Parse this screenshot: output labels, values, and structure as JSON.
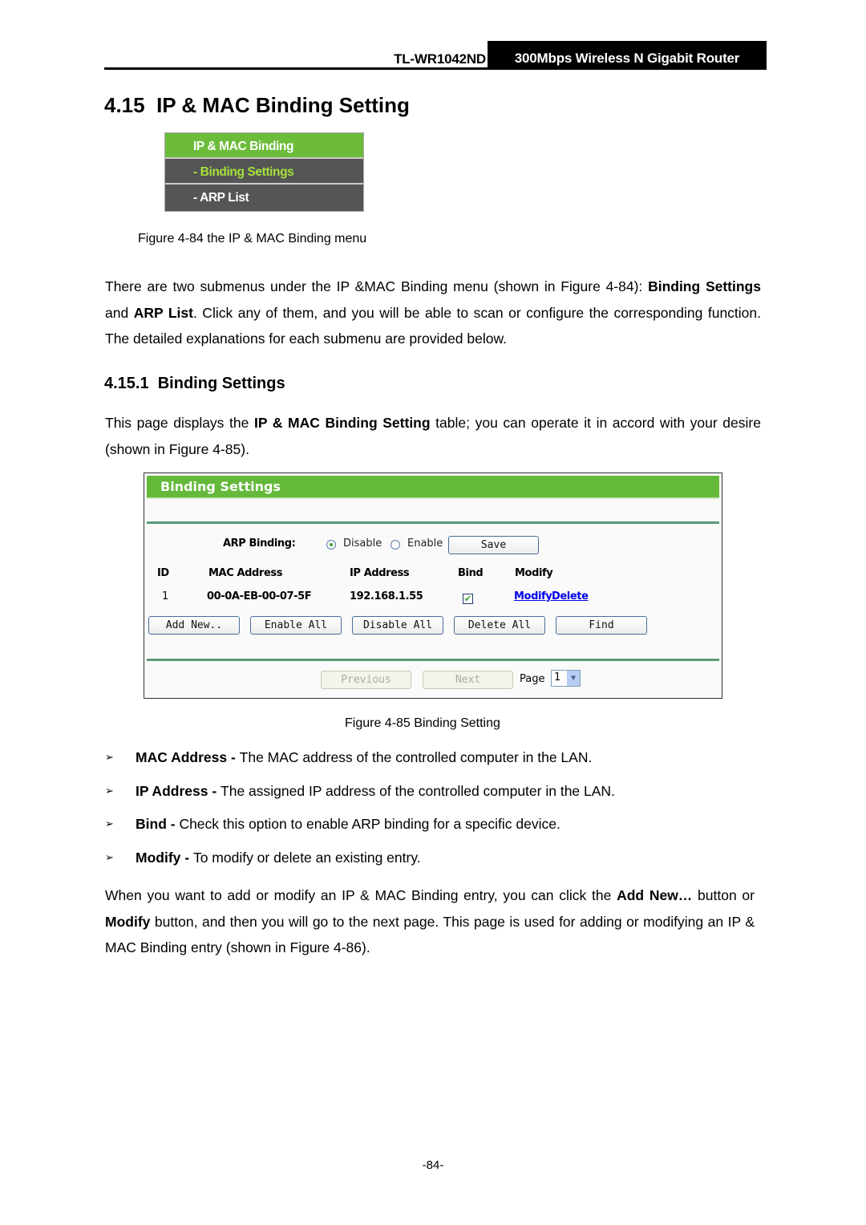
{
  "header": {
    "model": "TL-WR1042ND",
    "product": "300Mbps Wireless N Gigabit Router"
  },
  "section": {
    "number": "4.15",
    "title": "IP & MAC Binding Setting"
  },
  "menu_figure": {
    "items": [
      {
        "label": "IP & MAC Binding",
        "state": "header"
      },
      {
        "label": "- Binding Settings",
        "state": "selected"
      },
      {
        "label": "- ARP List",
        "state": "normal"
      }
    ],
    "caption": "Figure 4-84 the IP & MAC Binding menu"
  },
  "intro": {
    "t1": "There are two submenus under the IP &MAC Binding menu (shown in Figure 4-84): ",
    "b1": "Binding Settings",
    "t2": " and ",
    "b2": "ARP List",
    "t3": ". Click any of them, and you will be able to scan or configure the corresponding function. The detailed explanations for each submenu are provided below."
  },
  "subsection": {
    "number": "4.15.1",
    "title": "Binding Settings"
  },
  "sub_intro": {
    "t1": "This page displays the ",
    "b1": "IP & MAC Binding Setting",
    "t2": " table; you can operate it in accord with your desire (shown in Figure 4-85)."
  },
  "binding_figure": {
    "title": "Binding Settings",
    "arp_binding_label": "ARP Binding:",
    "radio_disable": "Disable",
    "radio_enable": "Enable",
    "arp_binding_value": "Disable",
    "save_button": "Save",
    "columns": [
      "ID",
      "MAC Address",
      "IP Address",
      "Bind",
      "Modify"
    ],
    "rows": [
      {
        "id": "1",
        "mac": "00-0A-EB-00-07-5F",
        "ip": "192.168.1.55",
        "bind": true,
        "modify_link": "Modify",
        "delete_link": "Delete"
      }
    ],
    "buttons": {
      "add_new": "Add New..",
      "enable_all": "Enable All",
      "disable_all": "Disable All",
      "delete_all": "Delete All",
      "find": "Find"
    },
    "pagination": {
      "previous": "Previous",
      "next": "Next",
      "page_label": "Page",
      "page_value": "1"
    },
    "caption": "Figure 4-85 Binding Setting"
  },
  "bullets": [
    {
      "term": "MAC Address - ",
      "text": "The MAC address of the controlled computer in the LAN."
    },
    {
      "term": "IP Address - ",
      "text": "The assigned IP address of the controlled computer in the LAN."
    },
    {
      "term": "Bind - ",
      "text": "Check this option to enable ARP binding for a specific device."
    },
    {
      "term": "Modify - ",
      "text": "To modify or delete an existing entry."
    }
  ],
  "outro": {
    "t1": "When you want to add or modify an IP & MAC Binding entry, you can click the ",
    "b1": "Add New…",
    "t2": " button or ",
    "b2": "Modify",
    "t3": " button, and then you will go to the next page. This page is used for adding or modifying an IP & MAC Binding entry (shown in Figure 4-86)."
  },
  "page_number": "-84-"
}
